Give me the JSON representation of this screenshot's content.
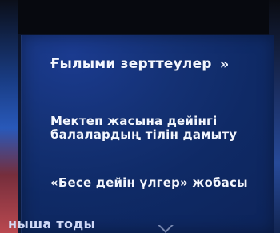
{
  "menu": {
    "items": [
      {
        "label": "Ғылыми зерттеулер",
        "chevron": "»"
      },
      {
        "label": "Мектеп жасына дейінгі балалардың тілін дамыту"
      },
      {
        "label": "«Бесе дейін үлгер» жобасы"
      }
    ]
  },
  "bottom_nav": {
    "partial_label": "ныша тоды"
  },
  "colors": {
    "panel_bg": "#143174",
    "text": "#f2f6ff",
    "header": "#07090f"
  },
  "icons": {
    "bottom": "chevron-down-icon"
  }
}
